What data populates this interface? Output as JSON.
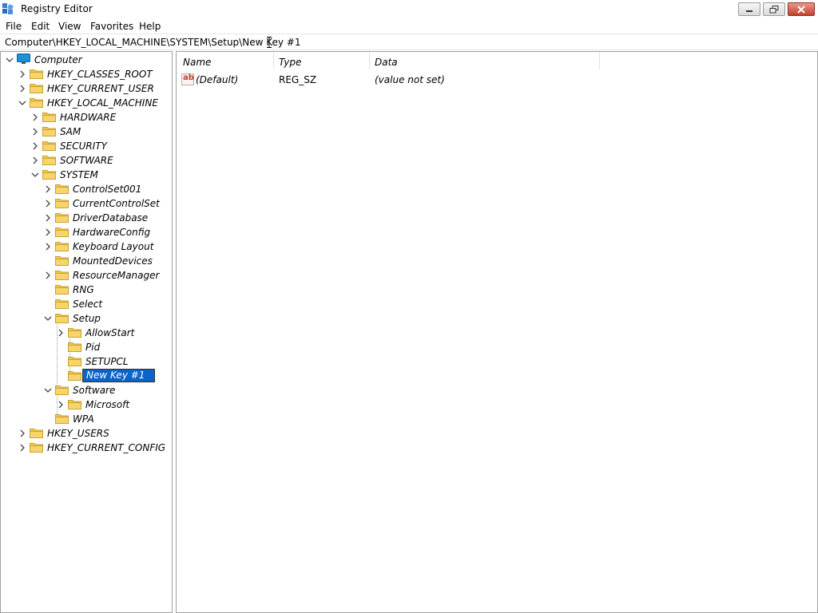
{
  "window": {
    "title": "Registry Editor"
  },
  "menu": [
    "File",
    "Edit",
    "View",
    "Favorites",
    "Help"
  ],
  "address": {
    "path": "Computer\\HKEY_LOCAL_MACHINE\\SYSTEM\\Setup\\New Key #1"
  },
  "tree": {
    "items": [
      {
        "label": "Computer",
        "icon": "computer-icon",
        "expanded": true
      },
      {
        "label": "HKEY_CLASSES_ROOT",
        "icon": "folder-icon",
        "expanded": false
      },
      {
        "label": "HKEY_CURRENT_USER",
        "icon": "folder-icon",
        "expanded": false
      },
      {
        "label": "HKEY_LOCAL_MACHINE",
        "icon": "folder-icon",
        "expanded": true
      },
      {
        "label": "HARDWARE",
        "icon": "folder-icon",
        "expanded": false
      },
      {
        "label": "SAM",
        "icon": "folder-icon",
        "expanded": false
      },
      {
        "label": "SECURITY",
        "icon": "folder-icon",
        "expanded": false
      },
      {
        "label": "SOFTWARE",
        "icon": "folder-icon",
        "expanded": false
      },
      {
        "label": "SYSTEM",
        "icon": "folder-icon",
        "expanded": true
      },
      {
        "label": "ControlSet001",
        "icon": "folder-icon",
        "expanded": false
      },
      {
        "label": "CurrentControlSet",
        "icon": "folder-icon",
        "expanded": false
      },
      {
        "label": "DriverDatabase",
        "icon": "folder-icon",
        "expanded": false
      },
      {
        "label": "HardwareConfig",
        "icon": "folder-icon",
        "expanded": false
      },
      {
        "label": "Keyboard Layout",
        "icon": "folder-icon",
        "expanded": false
      },
      {
        "label": "MountedDevices",
        "icon": "folder-icon",
        "expanded": null
      },
      {
        "label": "ResourceManager",
        "icon": "folder-icon",
        "expanded": false
      },
      {
        "label": "RNG",
        "icon": "folder-icon",
        "expanded": null
      },
      {
        "label": "Select",
        "icon": "folder-icon",
        "expanded": null
      },
      {
        "label": "Setup",
        "icon": "folder-icon",
        "expanded": true
      },
      {
        "label": "AllowStart",
        "icon": "folder-icon",
        "expanded": false
      },
      {
        "label": "Pid",
        "icon": "folder-icon",
        "expanded": null
      },
      {
        "label": "SETUPCL",
        "icon": "folder-icon",
        "expanded": null
      },
      {
        "label": "New Key #1",
        "icon": "folder-icon",
        "expanded": null,
        "editing": true
      },
      {
        "label": "Software",
        "icon": "folder-icon",
        "expanded": true
      },
      {
        "label": "Microsoft",
        "icon": "folder-icon",
        "expanded": false
      },
      {
        "label": "WPA",
        "icon": "folder-icon",
        "expanded": null
      },
      {
        "label": "HKEY_USERS",
        "icon": "folder-icon",
        "expanded": false
      },
      {
        "label": "HKEY_CURRENT_CONFIG",
        "icon": "folder-icon",
        "expanded": false
      }
    ]
  },
  "list": {
    "columns": [
      "Name",
      "Type",
      "Data"
    ],
    "rows": [
      {
        "name": "(Default)",
        "type": "REG_SZ",
        "data": "(value not set)",
        "icon": "string-value-icon"
      }
    ]
  },
  "colors": {
    "folder": "#f2c94c",
    "selection": "#0a64c8",
    "close_button": "#c4402c"
  }
}
